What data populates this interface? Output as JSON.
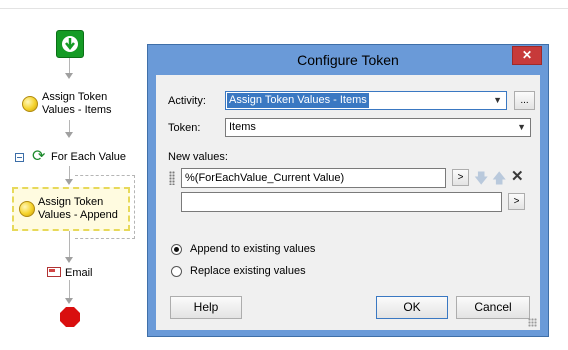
{
  "workflow": {
    "start": {
      "icon": "start-arrow-icon"
    },
    "assign_items": {
      "label": "Assign Token\nValues - Items",
      "icon": "coin-icon"
    },
    "for_each": {
      "label": "For Each Value",
      "icon": "loop-icon"
    },
    "assign_append": {
      "label": "Assign Token\nValues - Append",
      "icon": "coin-icon"
    },
    "email": {
      "label": "Email",
      "icon": "mail-icon"
    },
    "stop": {
      "icon": "stop-icon"
    }
  },
  "dialog": {
    "title": "Configure Token",
    "close_symbol": "✕",
    "activity_label": "Activity:",
    "activity_value": "Assign Token Values - Items",
    "browse_label": "...",
    "token_label": "Token:",
    "token_value": "Items",
    "new_values_label": "New values:",
    "values": [
      "%(ForEachValue_Current Value)",
      ""
    ],
    "row_btn_label": ">",
    "append_label": "Append to existing values",
    "replace_label": "Replace existing values",
    "mode": "append",
    "help_label": "Help",
    "ok_label": "OK",
    "cancel_label": "Cancel"
  },
  "colors": {
    "title_bar": "#6a9ad8",
    "close": "#c73a3a",
    "selection": "#3a78c2",
    "start": "#159b25",
    "stop": "#d90f0f"
  }
}
